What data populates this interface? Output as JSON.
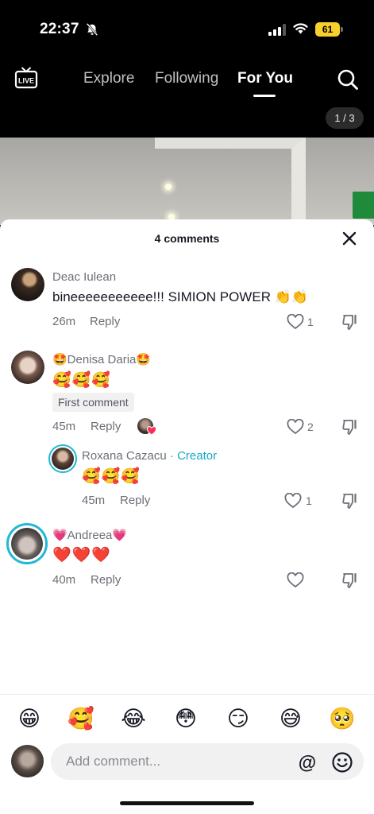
{
  "status_bar": {
    "time": "22:37",
    "battery": "61"
  },
  "top_nav": {
    "live_label": "LIVE",
    "tabs": [
      {
        "label": "Explore",
        "active": false
      },
      {
        "label": "Following",
        "active": false
      },
      {
        "label": "For You",
        "active": true
      }
    ],
    "page_indicator": "1 / 3"
  },
  "comments_sheet": {
    "title": "4 comments",
    "comments": [
      {
        "author": "Deac Iulean",
        "text": "bineeeeeeeeeee!!! SIMION POWER 👏👏",
        "time": "26m",
        "reply_label": "Reply",
        "likes": "1"
      },
      {
        "author": "🤩Denisa Daria🤩",
        "text": "🥰🥰🥰",
        "badge": "First comment",
        "time": "45m",
        "reply_label": "Reply",
        "likes": "2"
      },
      {
        "author": "Roxana Cazacu",
        "creator_tag": "· Creator",
        "text": "🥰🥰🥰",
        "time": "45m",
        "reply_label": "Reply",
        "likes": "1"
      },
      {
        "author": "💗Andreea💗",
        "text": "❤️❤️❤️",
        "time": "40m",
        "reply_label": "Reply",
        "likes": ""
      }
    ]
  },
  "emoji_bar": [
    "😁",
    "🥰",
    "😂",
    "😳",
    "😏",
    "😅",
    "🥺"
  ],
  "comment_input": {
    "placeholder": "Add comment..."
  },
  "colors": {
    "accent": "#1aa7c6",
    "battery": "#f7d02c",
    "like_heart": "#fe2c55"
  }
}
